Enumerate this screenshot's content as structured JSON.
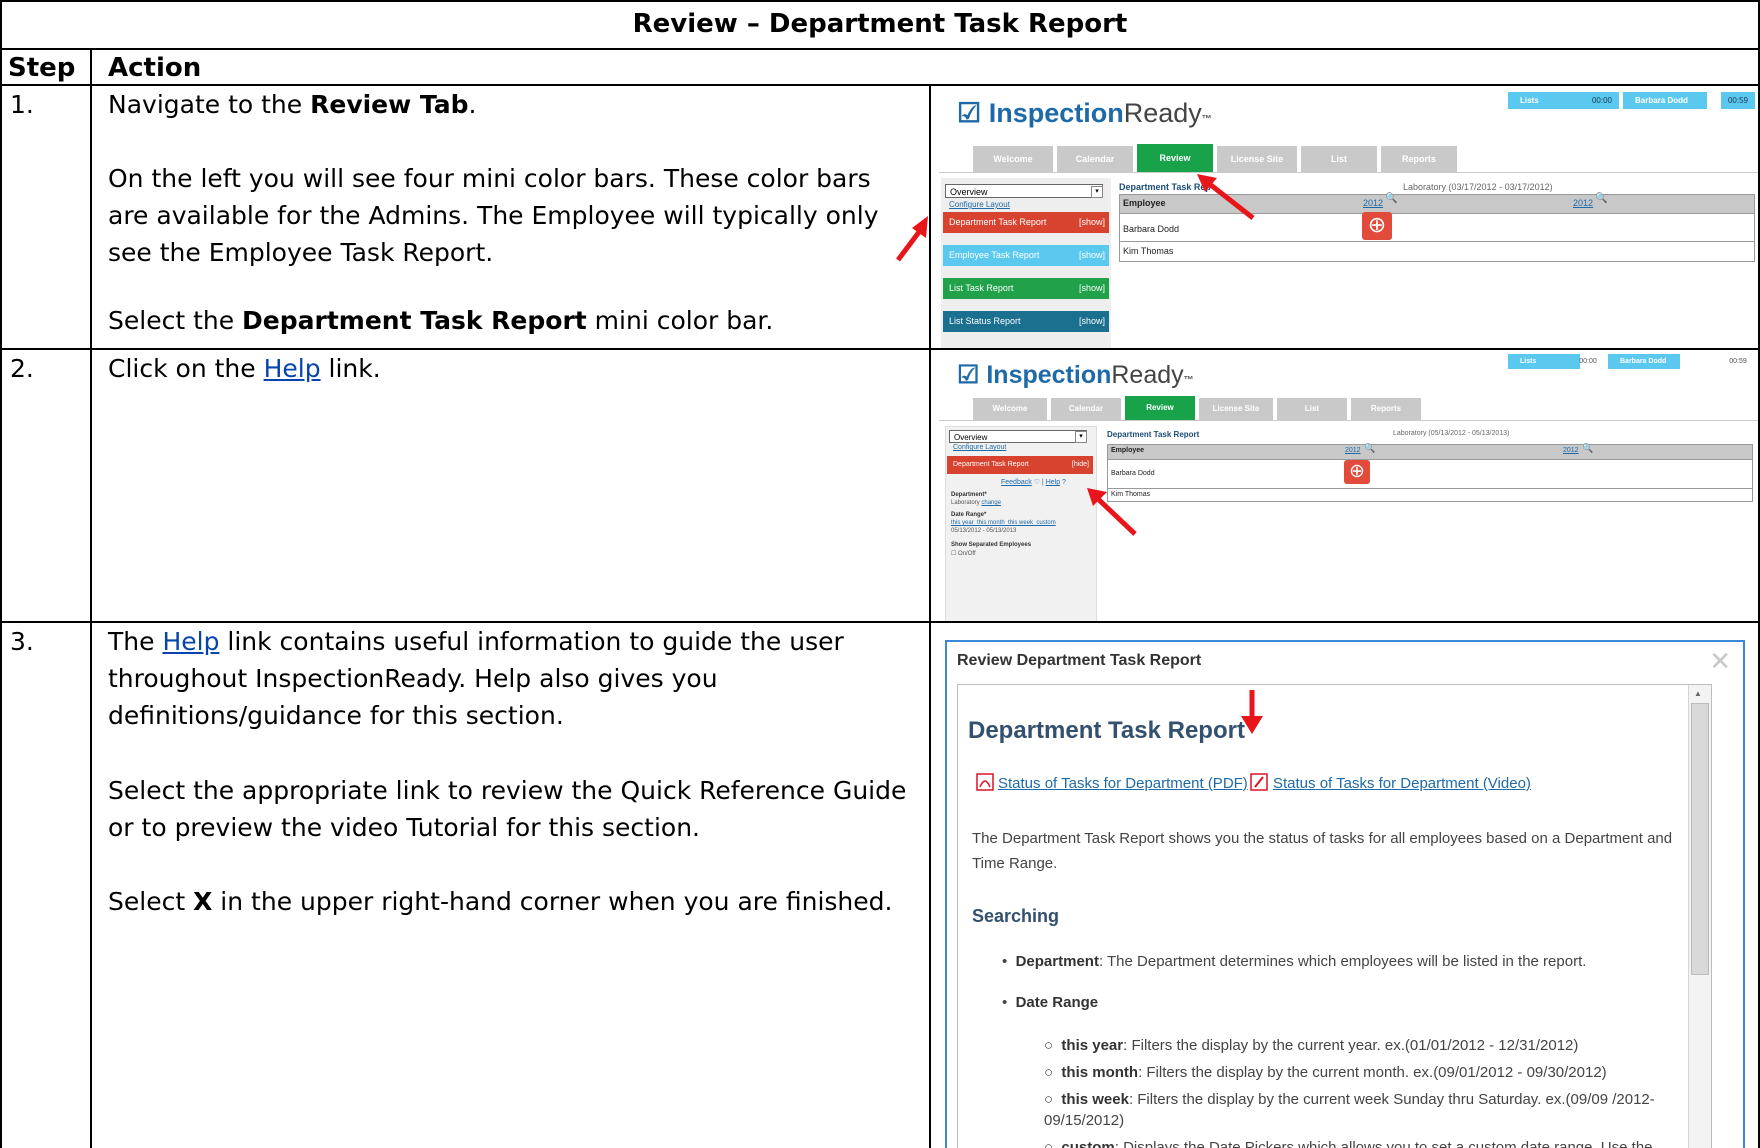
{
  "document": {
    "title": "Review – Department Task Report",
    "col_step": "Step",
    "col_action": "Action"
  },
  "rows": [
    {
      "step": "1.",
      "p1_pre": "Navigate to the ",
      "p1_bold": "Review Tab",
      "p1_post": ".",
      "p2": "On the left you will see four mini color bars.  These color bars are available for the Admins.  The Employee will typically only see the Employee Task Report.",
      "p3_pre": "Select the ",
      "p3_bold": "Department Task Report",
      "p3_post": " mini color bar."
    },
    {
      "step": "2.",
      "p1_pre": "Click on the ",
      "p1_link": "Help",
      "p1_post": " link."
    },
    {
      "step": "3.",
      "p1_pre": "The ",
      "p1_link": "Help",
      "p1_post": " link contains useful information to guide the user throughout InspectionReady.  Help also gives you definitions/guidance for this section.",
      "p2": "Select the appropriate link to review the Quick Reference Guide or to preview the video Tutorial for this section.",
      "p3_pre": "Select ",
      "p3_bold": "X",
      "p3_post": " in the upper right-hand corner when you are finished."
    }
  ],
  "app": {
    "logo_inspection": "Inspection",
    "logo_ready": "Ready",
    "logo_tm": "™",
    "lists": "Lists",
    "time1": "00:00",
    "user": "Barbara Dodd",
    "time2": "00:59",
    "tabs": [
      "Welcome",
      "Calendar",
      "Review",
      "License Site",
      "List",
      "Reports"
    ],
    "overview": "Overview",
    "configure_layout": "Configure Layout",
    "bars": [
      {
        "label": "Department Task Report",
        "action": "[show]",
        "color": "#d8432f"
      },
      {
        "label": "Employee Task Report",
        "action": "[show]",
        "color": "#5bc8ef"
      },
      {
        "label": "List Task Report",
        "action": "[show]",
        "color": "#20a14a"
      },
      {
        "label": "List Status Report",
        "action": "[show]",
        "color": "#1b6f8f"
      }
    ],
    "hide_action": "[hide]",
    "report_title_short": "Department Task Rep",
    "report_title": "Department Task Report",
    "range1": "Laboratory (03/17/2012 - 03/17/2012)",
    "range2": "Laboratory (05/13/2012 - 05/13/2013)",
    "col_employee": "Employee",
    "year1": "2012",
    "year2": "2012",
    "employees": [
      "Barbara Dodd",
      "Kim Thomas"
    ],
    "feedback": "Feedback",
    "help": "Help",
    "department_label": "Department*",
    "department_value": "Laboratory",
    "change": "change",
    "date_range_label": "Date Range*",
    "date_links": "this year  this month  this week  custom",
    "date_value": "05/13/2012 - 05/13/2013",
    "show_separated": "Show Separated Employees",
    "onoff": "On/Off"
  },
  "help_dialog": {
    "window_title": "Review Department Task Report",
    "close": "✕",
    "heading": "Department Task Report",
    "link_pdf": "Status of Tasks for Department (PDF)",
    "link_video": "Status of Tasks for Department (Video)",
    "intro": "The Department Task Report shows you the status of tasks for all employees based on a Department and Time Range.",
    "searching": "Searching",
    "dept_term": "Department",
    "dept_desc": ": The Department determines which employees will be listed in the report.",
    "date_range": "Date Range",
    "options": [
      {
        "term": "this year",
        "desc": ": Filters the display by the current year. ex.(01/01/2012 - 12/31/2012)"
      },
      {
        "term": "this month",
        "desc": ": Filters the display by the current month. ex.(09/01/2012 - 09/30/2012)"
      },
      {
        "term": "this week",
        "desc": ": Filters the display by the current week Sunday thru Saturday. ex.(09/09 /2012-09/15/2012)"
      },
      {
        "term": "custom",
        "desc": ": Displays the Date Pickers which allows you to set a custom date range. Use the Update Display to filter by the date pickers."
      }
    ]
  },
  "colors": {
    "review_tab": "#18a34a",
    "inactive_tab": "#c9c9c9",
    "pill_blue": "#5bc8ef",
    "arrow_red": "#e8161b",
    "link_blue": "#0645ad"
  }
}
